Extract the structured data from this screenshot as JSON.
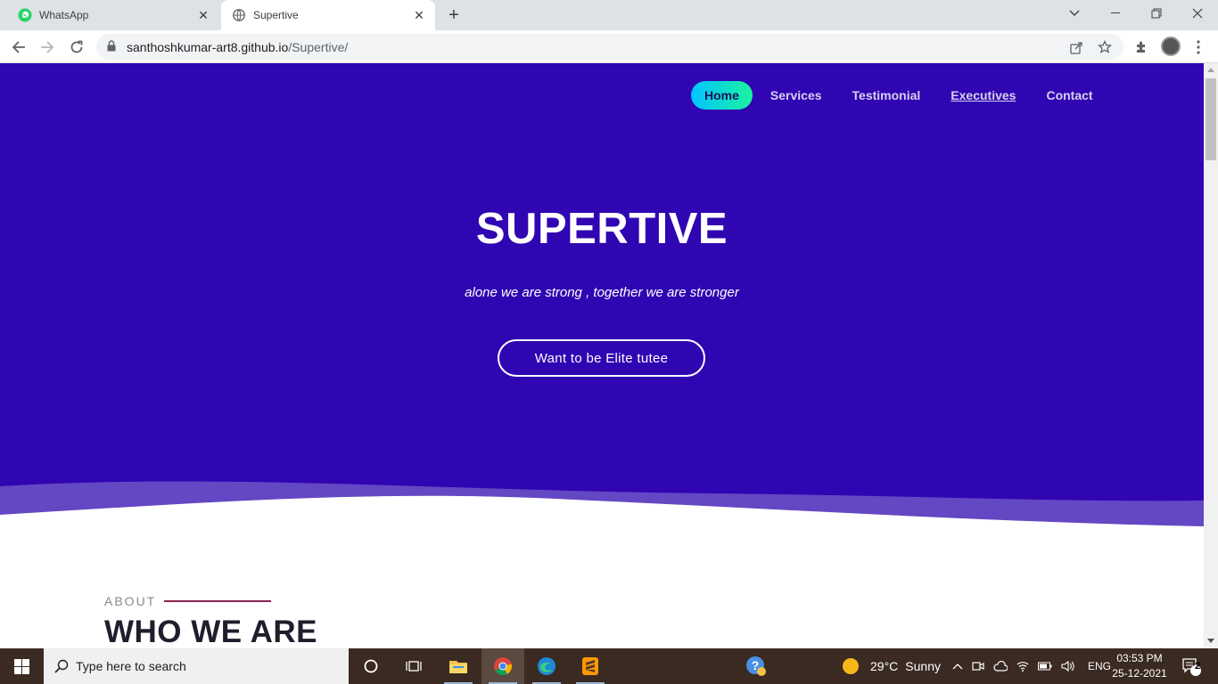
{
  "browser": {
    "tabs": [
      {
        "title": "WhatsApp",
        "active": false
      },
      {
        "title": "Supertive",
        "active": true
      }
    ],
    "url_host": "santhoshkumar-art8.github.io",
    "url_path": "/Supertive/"
  },
  "site": {
    "nav": [
      "Home",
      "Services",
      "Testimonial",
      "Executives",
      "Contact"
    ],
    "hero_title": "SUPERTIVE",
    "hero_subtitle": "alone we are strong , together we are stronger",
    "hero_button": "Want to be Elite tutee",
    "about_label": "ABOUT",
    "about_title": "WHO WE ARE",
    "colors": {
      "hero_bg": "#3005b2",
      "wave_light": "#6a4fc4",
      "accent_line": "#8a2450"
    }
  },
  "taskbar": {
    "search_placeholder": "Type here to search",
    "weather_temp": "29°C",
    "weather_desc": "Sunny",
    "language": "ENG",
    "time": "03:53 PM",
    "date": "25-12-2021",
    "notification_count": "2"
  }
}
